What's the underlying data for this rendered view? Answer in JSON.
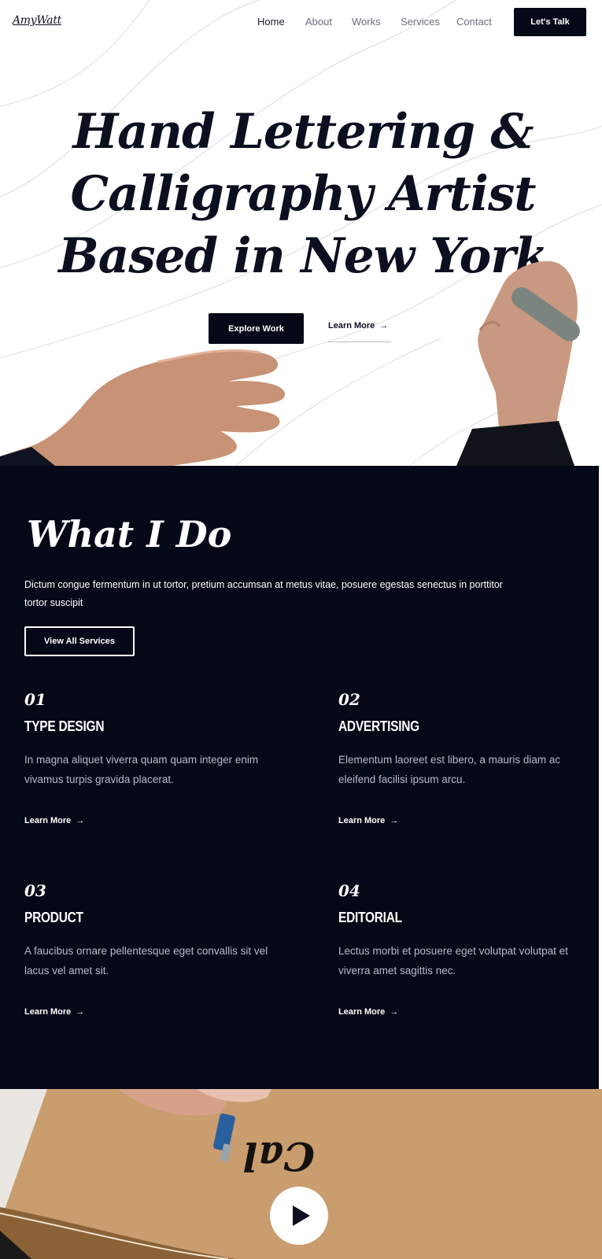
{
  "nav": {
    "logo": "AmyWatt",
    "items": [
      {
        "label": "Home",
        "active": true
      },
      {
        "label": "About",
        "active": false
      },
      {
        "label": "Works",
        "active": false
      },
      {
        "label": "Services",
        "active": false
      },
      {
        "label": "Contact",
        "active": false
      }
    ],
    "cta": "Let's Talk"
  },
  "hero": {
    "title_lines": [
      "Hand Lettering &",
      "Calligraphy Artist",
      "Based in New York"
    ],
    "primary_button": "Explore Work",
    "secondary_link": "Learn More",
    "arrow": "→"
  },
  "services": {
    "title": "What I Do",
    "intro": "Dictum congue fermentum in ut tortor, pretium accumsan at metus vitae, posuere egestas senectus in porttitor tortor suscipit",
    "view_all": "View All Services",
    "items": [
      {
        "number": "01",
        "name": "TYPE DESIGN",
        "description": "In magna aliquet viverra quam quam integer enim vivamus turpis gravida placerat.",
        "link": "Learn More"
      },
      {
        "number": "02",
        "name": "ADVERTISING",
        "description": "Elementum laoreet est libero, a mauris diam ac eleifend facilisi ipsum arcu.",
        "link": "Learn More"
      },
      {
        "number": "03",
        "name": "PRODUCT",
        "description": "A faucibus ornare pellentesque eget convallis sit vel lacus vel amet sit.",
        "link": "Learn More"
      },
      {
        "number": "04",
        "name": "EDITORIAL",
        "description": "Lectus morbi et posuere eget volutpat volutpat et viverra amet sagittis nec.",
        "link": "Learn More"
      }
    ],
    "arrow": "→"
  },
  "video": {
    "play_icon": "play-icon"
  },
  "colors": {
    "dark": "#050816",
    "text_muted": "#b9bcc7",
    "nav_muted": "#6b6e78",
    "paper": "#c89c6c"
  }
}
